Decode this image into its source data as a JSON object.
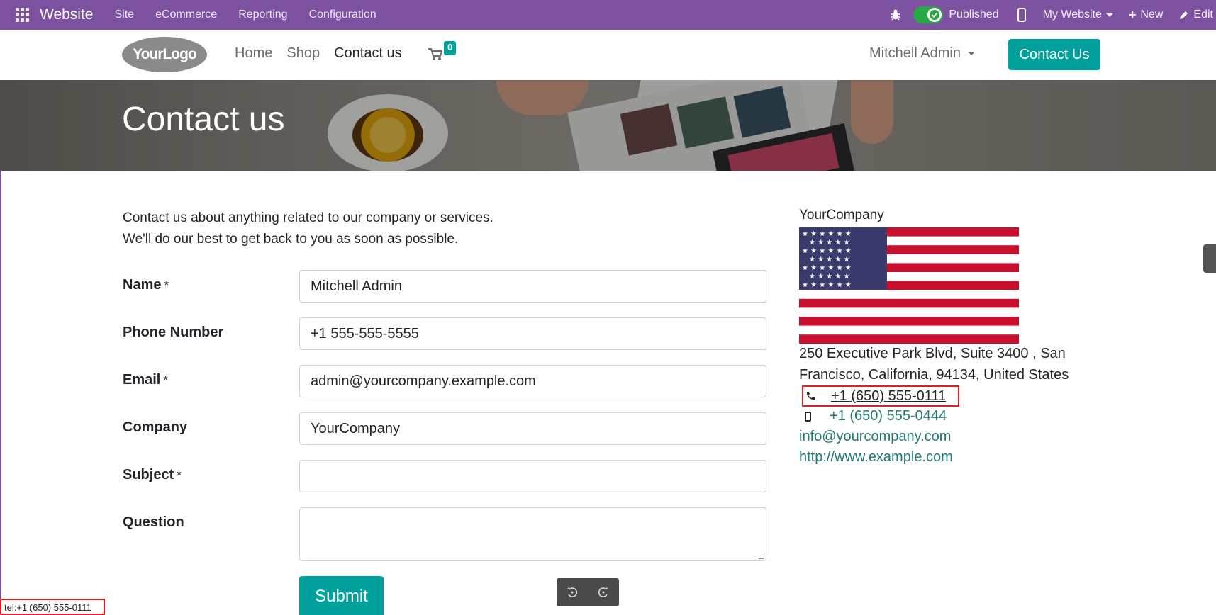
{
  "admin_bar": {
    "app_name": "Website",
    "menu": [
      "Site",
      "eCommerce",
      "Reporting",
      "Configuration"
    ],
    "published_label": "Published",
    "website_selector": "My Website",
    "new_label": "New",
    "edit_label": "Edit"
  },
  "header": {
    "logo_text": "YourLogo",
    "nav": [
      "Home",
      "Shop",
      "Contact us"
    ],
    "cart_count": "0",
    "user_name": "Mitchell Admin",
    "contact_button": "Contact Us"
  },
  "banner": {
    "title": "Contact us"
  },
  "intro": {
    "line1": "Contact us about anything related to our company or services.",
    "line2": "We'll do our best to get back to you as soon as possible."
  },
  "form": {
    "name_label": "Name",
    "name_value": "Mitchell Admin",
    "phone_label": "Phone Number",
    "phone_value": "+1 555-555-5555",
    "email_label": "Email",
    "email_value": "admin@yourcompany.example.com",
    "company_label": "Company",
    "company_value": "YourCompany",
    "subject_label": "Subject",
    "subject_value": "",
    "question_label": "Question",
    "question_value": "",
    "required_mark": "*",
    "submit_label": "Submit"
  },
  "company_info": {
    "name": "YourCompany",
    "address_line1": "250 Executive Park Blvd, Suite 3400 , San",
    "address_line2": "Francisco, California, 94134, United States",
    "phone": "+1 (650) 555-0111",
    "mobile": "+1 (650) 555-0444",
    "email": "info@yourcompany.com",
    "website": "http://www.example.com"
  },
  "status_bar": {
    "url": "tel:+1 (650) 555-0111"
  },
  "colors": {
    "admin_bar": "#7c52a0",
    "primary": "#00a09d",
    "link": "#1f7a73",
    "highlight": "#e02020"
  },
  "icons": [
    "apps-grid-icon",
    "bug-icon",
    "check-icon",
    "mobile-icon",
    "plus-icon",
    "pencil-icon",
    "cart-icon",
    "phone-icon",
    "undo-icon",
    "redo-icon"
  ]
}
